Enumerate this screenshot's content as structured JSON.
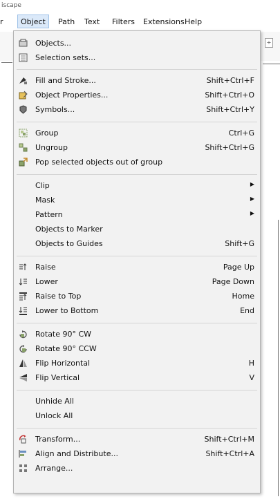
{
  "window": {
    "title": "iscape"
  },
  "menubar": {
    "items": [
      {
        "label": "r"
      },
      {
        "label": "Object",
        "active": true
      },
      {
        "label": "Path"
      },
      {
        "label": "Text"
      },
      {
        "label": "Filters"
      },
      {
        "label": "Extensions"
      },
      {
        "label": "Help"
      }
    ]
  },
  "menu": {
    "items": [
      {
        "icon": "objects-icon",
        "label": "Objects...",
        "shortcut": ""
      },
      {
        "icon": "selection-sets-icon",
        "label": "Selection sets...",
        "shortcut": ""
      },
      {
        "icon": "fill-stroke-icon",
        "label": "Fill and Stroke...",
        "shortcut": "Shift+Ctrl+F"
      },
      {
        "icon": "object-properties-icon",
        "label": "Object Properties...",
        "shortcut": "Shift+Ctrl+O"
      },
      {
        "icon": "symbols-icon",
        "label": "Symbols...",
        "shortcut": "Shift+Ctrl+Y"
      },
      {
        "icon": "group-icon",
        "label": "Group",
        "shortcut": "Ctrl+G"
      },
      {
        "icon": "ungroup-icon",
        "label": "Ungroup",
        "shortcut": "Shift+Ctrl+G"
      },
      {
        "icon": "pop-out-group-icon",
        "label": "Pop selected objects out of group",
        "shortcut": ""
      },
      {
        "icon": "",
        "label": "Clip",
        "shortcut": "",
        "submenu": true
      },
      {
        "icon": "",
        "label": "Mask",
        "shortcut": "",
        "submenu": true
      },
      {
        "icon": "",
        "label": "Pattern",
        "shortcut": "",
        "submenu": true
      },
      {
        "icon": "",
        "label": "Objects to Marker",
        "shortcut": ""
      },
      {
        "icon": "",
        "label": "Objects to Guides",
        "shortcut": "Shift+G"
      },
      {
        "icon": "raise-icon",
        "label": "Raise",
        "shortcut": "Page Up"
      },
      {
        "icon": "lower-icon",
        "label": "Lower",
        "shortcut": "Page Down"
      },
      {
        "icon": "raise-to-top-icon",
        "label": "Raise to Top",
        "shortcut": "Home"
      },
      {
        "icon": "lower-to-bottom-icon",
        "label": "Lower to Bottom",
        "shortcut": "End"
      },
      {
        "icon": "rotate-cw-icon",
        "label": "Rotate 90° CW",
        "shortcut": ""
      },
      {
        "icon": "rotate-ccw-icon",
        "label": "Rotate 90° CCW",
        "shortcut": ""
      },
      {
        "icon": "flip-horizontal-icon",
        "label": "Flip Horizontal",
        "shortcut": "H"
      },
      {
        "icon": "flip-vertical-icon",
        "label": "Flip Vertical",
        "shortcut": "V"
      },
      {
        "icon": "",
        "label": "Unhide All",
        "shortcut": ""
      },
      {
        "icon": "",
        "label": "Unlock All",
        "shortcut": ""
      },
      {
        "icon": "transform-icon",
        "label": "Transform...",
        "shortcut": "Shift+Ctrl+M"
      },
      {
        "icon": "align-distribute-icon",
        "label": "Align and Distribute...",
        "shortcut": "Shift+Ctrl+A"
      },
      {
        "icon": "arrange-icon",
        "label": "Arrange...",
        "shortcut": ""
      }
    ]
  },
  "toolbar": {
    "spin_glyph": "÷"
  },
  "colors": {
    "menu_bg": "#f2f2f2",
    "active_menu": "#dbe9f9",
    "separator": "#d4d4d4"
  }
}
